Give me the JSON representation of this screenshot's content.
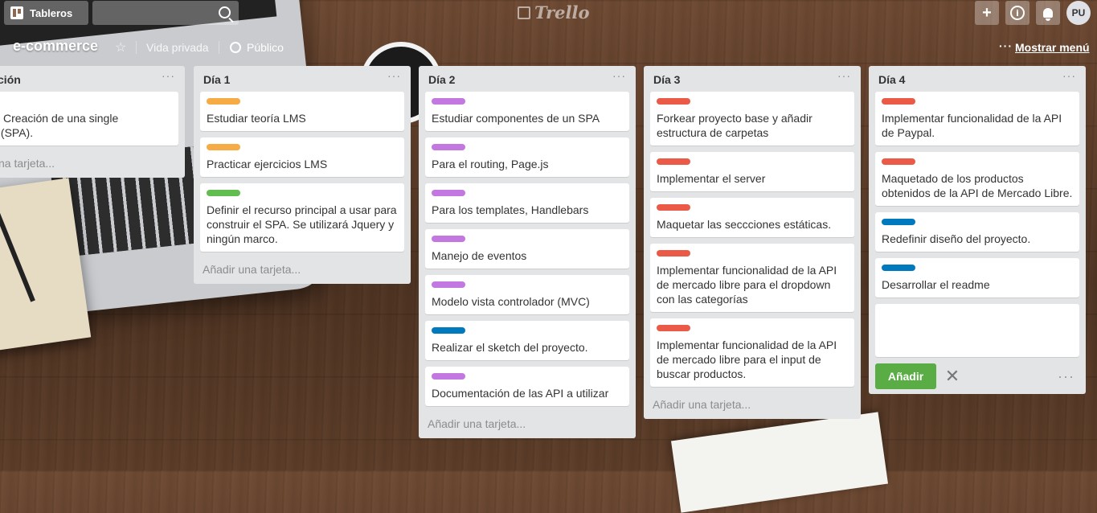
{
  "header": {
    "boards_label": "Tableros",
    "logo_text": "Trello",
    "avatar_initials": "PU",
    "plus_glyph": "+",
    "info_glyph": "i"
  },
  "board": {
    "title": "e-commerce",
    "privacy": "Vida privada",
    "visibility": "Público",
    "menu_dots": "···",
    "show_menu": "Mostrar menú"
  },
  "colors": {
    "orange": "#f6ab44",
    "green": "#61bd4f",
    "purple": "#c377e0",
    "red": "#eb5a46",
    "blue": "#0079bf"
  },
  "lists": [
    {
      "title": "anización",
      "menu": "···",
      "cards": [
        {
          "text": "ducto: Creación de una single\ne app (SPA).",
          "label": null
        }
      ],
      "add_text": "adir una tarjeta..."
    },
    {
      "title": "Día 1",
      "menu": "···",
      "cards": [
        {
          "text": "Estudiar teoría LMS",
          "label": "orange"
        },
        {
          "text": "Practicar ejercicios LMS",
          "label": "orange"
        },
        {
          "text": "Definir el recurso principal a usar para construir el SPA. Se utilizará Jquery y ningún marco.",
          "label": "green"
        }
      ],
      "add_text": "Añadir una tarjeta..."
    },
    {
      "title": "Día 2",
      "menu": "···",
      "cards": [
        {
          "text": "Estudiar componentes de un SPA",
          "label": "purple"
        },
        {
          "text": "Para el routing, Page.js",
          "label": "purple"
        },
        {
          "text": "Para los templates, Handlebars",
          "label": "purple"
        },
        {
          "text": "Manejo de eventos",
          "label": "purple"
        },
        {
          "text": "Modelo vista controlador (MVC)",
          "label": "purple"
        },
        {
          "text": "Realizar el sketch del proyecto.",
          "label": "blue"
        },
        {
          "text": "Documentación de las API a utilizar",
          "label": "purple"
        }
      ],
      "add_text": "Añadir una tarjeta..."
    },
    {
      "title": "Día 3",
      "menu": "···",
      "cards": [
        {
          "text": "Forkear proyecto base y añadir estructura de carpetas",
          "label": "red"
        },
        {
          "text": "Implementar el server",
          "label": "red"
        },
        {
          "text": "Maquetar las seccciones estáticas.",
          "label": "red"
        },
        {
          "text": "Implementar funcionalidad de la API de mercado libre para el dropdown con las categorías",
          "label": "red"
        },
        {
          "text": "Implementar funcionalidad de la API de mercado libre para el input de buscar productos.",
          "label": "red"
        }
      ],
      "add_text": "Añadir una tarjeta..."
    },
    {
      "title": "Día 4",
      "menu": "···",
      "cards": [
        {
          "text": "Implementar funcionalidad de la API de Paypal.",
          "label": "red"
        },
        {
          "text": "Maquetado de los productos obtenidos de la API de Mercado Libre.",
          "label": "red"
        },
        {
          "text": "Redefinir diseño del proyecto.",
          "label": "blue"
        },
        {
          "text": "Desarrollar el readme",
          "label": "blue"
        }
      ],
      "composer": {
        "add_button": "Añadir",
        "close_glyph": "✕",
        "more_glyph": "···"
      }
    }
  ]
}
